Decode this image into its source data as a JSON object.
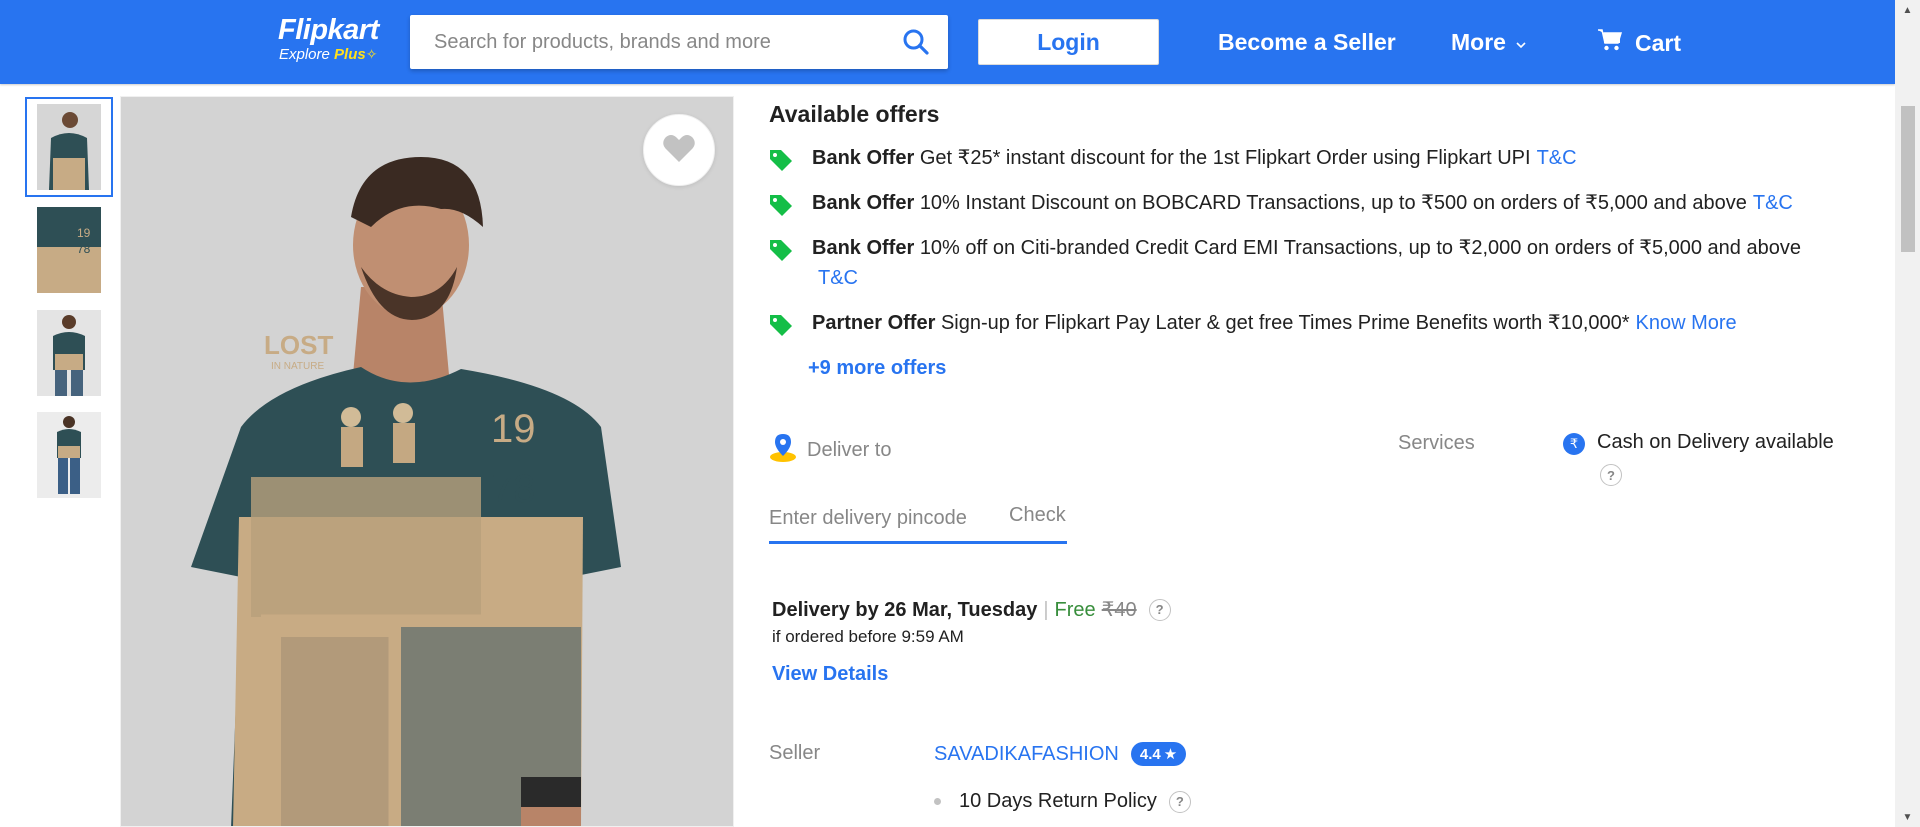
{
  "header": {
    "logo_main": "Flipkart",
    "logo_sub_prefix": "Explore",
    "logo_sub_plus": "Plus",
    "search_placeholder": "Search for products, brands and more",
    "login_label": "Login",
    "seller_label": "Become a Seller",
    "more_label": "More",
    "cart_label": "Cart",
    "brand_color": "#2874f0"
  },
  "gallery": {
    "thumbnails": [
      {
        "name": "front-view",
        "active": true
      },
      {
        "name": "print-closeup",
        "active": false
      },
      {
        "name": "side-view",
        "active": false
      },
      {
        "name": "full-outfit",
        "active": false
      }
    ],
    "main_print_text": "LOST",
    "main_print_sub": "IN NATURE",
    "main_print_year_top": "19",
    "main_print_year_bottom": "78"
  },
  "offers": {
    "title": "Available offers",
    "items": [
      {
        "type": "Bank Offer",
        "text": "Get ₹25* instant discount for the 1st Flipkart Order using Flipkart UPI",
        "link": "T&C"
      },
      {
        "type": "Bank Offer",
        "text": "10% Instant Discount on BOBCARD Transactions, up to ₹500 on orders of ₹5,000 and above",
        "link": "T&C"
      },
      {
        "type": "Bank Offer",
        "text": "10% off on Citi-branded Credit Card EMI Transactions, up to ₹2,000 on orders of ₹5,000 and above",
        "link": "T&C"
      },
      {
        "type": "Partner Offer",
        "text": "Sign-up for Flipkart Pay Later & get free Times Prime Benefits worth ₹10,000*",
        "link": "Know More"
      }
    ],
    "more_link": "+9 more offers"
  },
  "delivery": {
    "label": "Deliver to",
    "pincode_placeholder": "Enter delivery pincode",
    "check_label": "Check",
    "date_text": "Delivery by 26 Mar, Tuesday",
    "separator": "|",
    "free_label": "Free",
    "original_charge": "₹40",
    "condition": "if ordered before 9:59 AM",
    "view_details": "View Details"
  },
  "services": {
    "label": "Services",
    "items": [
      {
        "text": "Cash on Delivery available",
        "icon": "rupee-icon"
      }
    ]
  },
  "seller": {
    "label": "Seller",
    "name": "SAVADIKAFASHION",
    "rating": "4.4",
    "policy": "10 Days Return Policy"
  },
  "help_mark": "?"
}
